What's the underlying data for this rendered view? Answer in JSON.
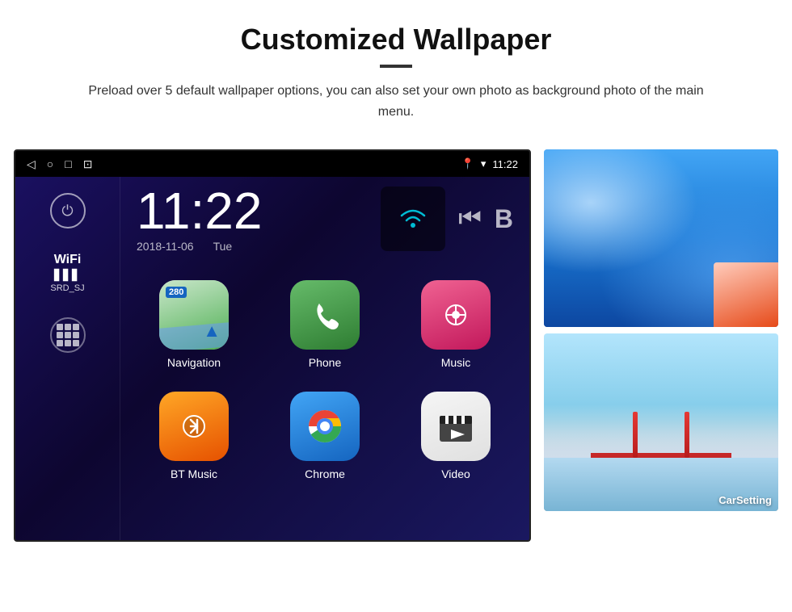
{
  "header": {
    "title": "Customized Wallpaper",
    "subtitle": "Preload over 5 default wallpaper options, you can also set your own photo as background photo of the main menu."
  },
  "android": {
    "statusBar": {
      "time": "11:22",
      "icons_left": [
        "back-arrow",
        "home-circle",
        "square-recents",
        "screenshot"
      ],
      "icons_right": [
        "location-pin",
        "wifi-signal",
        "time"
      ]
    },
    "clock": {
      "time": "11:22",
      "date": "2018-11-06",
      "day": "Tue"
    },
    "sidebar": {
      "wifi_label": "WiFi",
      "wifi_signal": "▋▋▋",
      "wifi_name": "SRD_SJ"
    },
    "apps": [
      {
        "name": "Navigation",
        "icon_type": "navigation",
        "label": "Navigation"
      },
      {
        "name": "Phone",
        "icon_type": "phone",
        "label": "Phone"
      },
      {
        "name": "Music",
        "icon_type": "music",
        "label": "Music"
      },
      {
        "name": "BT Music",
        "icon_type": "bt",
        "label": "BT Music"
      },
      {
        "name": "Chrome",
        "icon_type": "chrome",
        "label": "Chrome"
      },
      {
        "name": "Video",
        "icon_type": "video",
        "label": "Video"
      }
    ]
  },
  "wallpapers": [
    {
      "name": "ice-cave",
      "label": ""
    },
    {
      "name": "golden-gate",
      "label": "CarSetting"
    }
  ]
}
